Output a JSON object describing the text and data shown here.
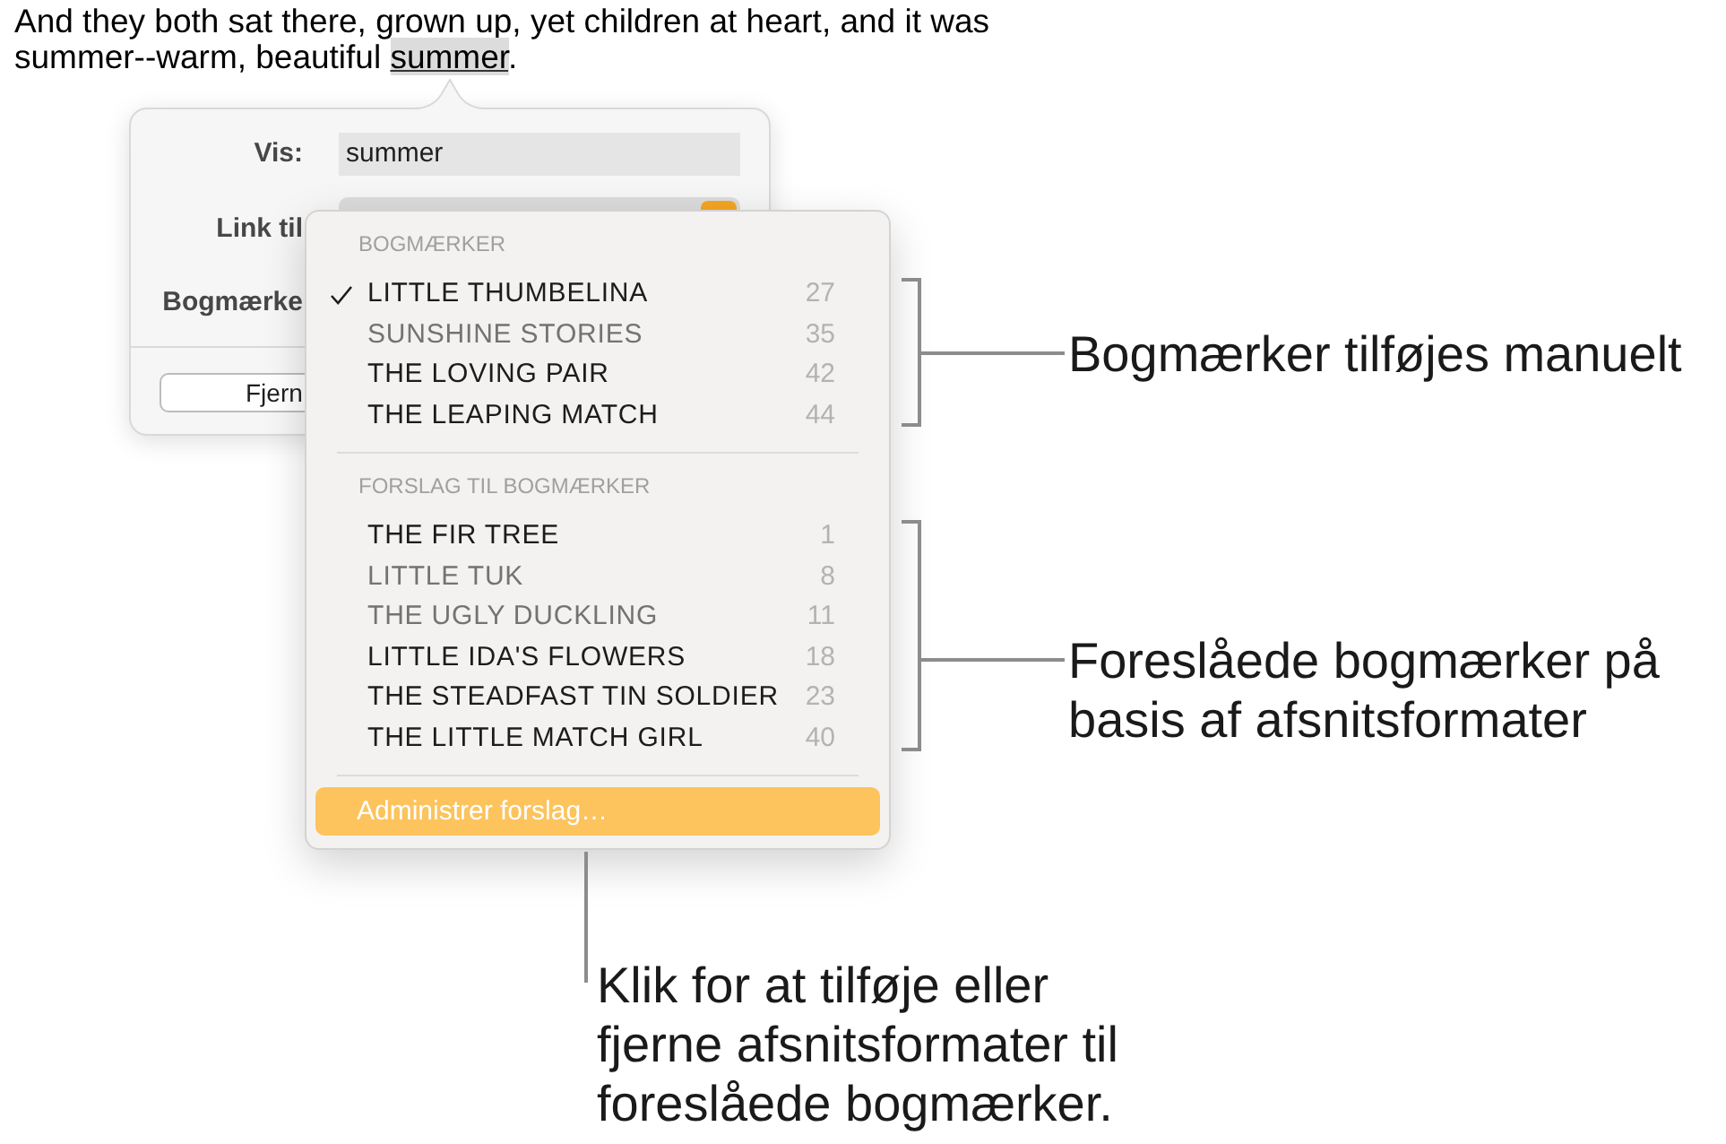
{
  "document": {
    "text_before": "And they both sat there, grown up, yet children at heart, and it was summer--warm, beautiful ",
    "selection": "summer",
    "text_after": "."
  },
  "link_editor": {
    "rows": [
      {
        "kind": "field",
        "label": "Vis:",
        "value": "summer"
      },
      {
        "kind": "popup",
        "label": "Link til"
      },
      {
        "kind": "plain",
        "label": "Bogmærke"
      }
    ],
    "button": "Fjern"
  },
  "bookmark_menu": {
    "sections": [
      {
        "heading": "BOGMÆRKER",
        "items": [
          {
            "title": "LITTLE THUMBELINA",
            "page": "27",
            "checked": true,
            "dimmed": false
          },
          {
            "title": "SUNSHINE STORIES",
            "page": "35",
            "checked": false,
            "dimmed": true
          },
          {
            "title": "THE LOVING PAIR",
            "page": "42",
            "checked": false,
            "dimmed": false
          },
          {
            "title": "THE LEAPING MATCH",
            "page": "44",
            "checked": false,
            "dimmed": false
          }
        ]
      },
      {
        "heading": "FORSLAG TIL BOGMÆRKER",
        "items": [
          {
            "title": "THE FIR TREE",
            "page": "1",
            "checked": false,
            "dimmed": false
          },
          {
            "title": "LITTLE TUK",
            "page": "8",
            "checked": false,
            "dimmed": true
          },
          {
            "title": "THE UGLY DUCKLING",
            "page": "11",
            "checked": false,
            "dimmed": true
          },
          {
            "title": "LITTLE IDA'S FLOWERS",
            "page": "18",
            "checked": false,
            "dimmed": false
          },
          {
            "title": "THE STEADFAST TIN SOLDIER",
            "page": "23",
            "checked": false,
            "dimmed": false
          },
          {
            "title": "THE LITTLE MATCH GIRL",
            "page": "40",
            "checked": false,
            "dimmed": false
          }
        ]
      }
    ],
    "action": {
      "label": "Administrer forslag…",
      "highlighted": true
    }
  },
  "callouts": [
    {
      "kind": "bracket",
      "text": "Bogmærker tilføjes manuelt"
    },
    {
      "kind": "bracket",
      "text": "Foreslåede bogmærker på basis af afsnitsformater"
    },
    {
      "kind": "pointer",
      "text": "Klik for at tilføje eller fjerne afsnitsformater til foreslåede bogmærker."
    }
  ]
}
